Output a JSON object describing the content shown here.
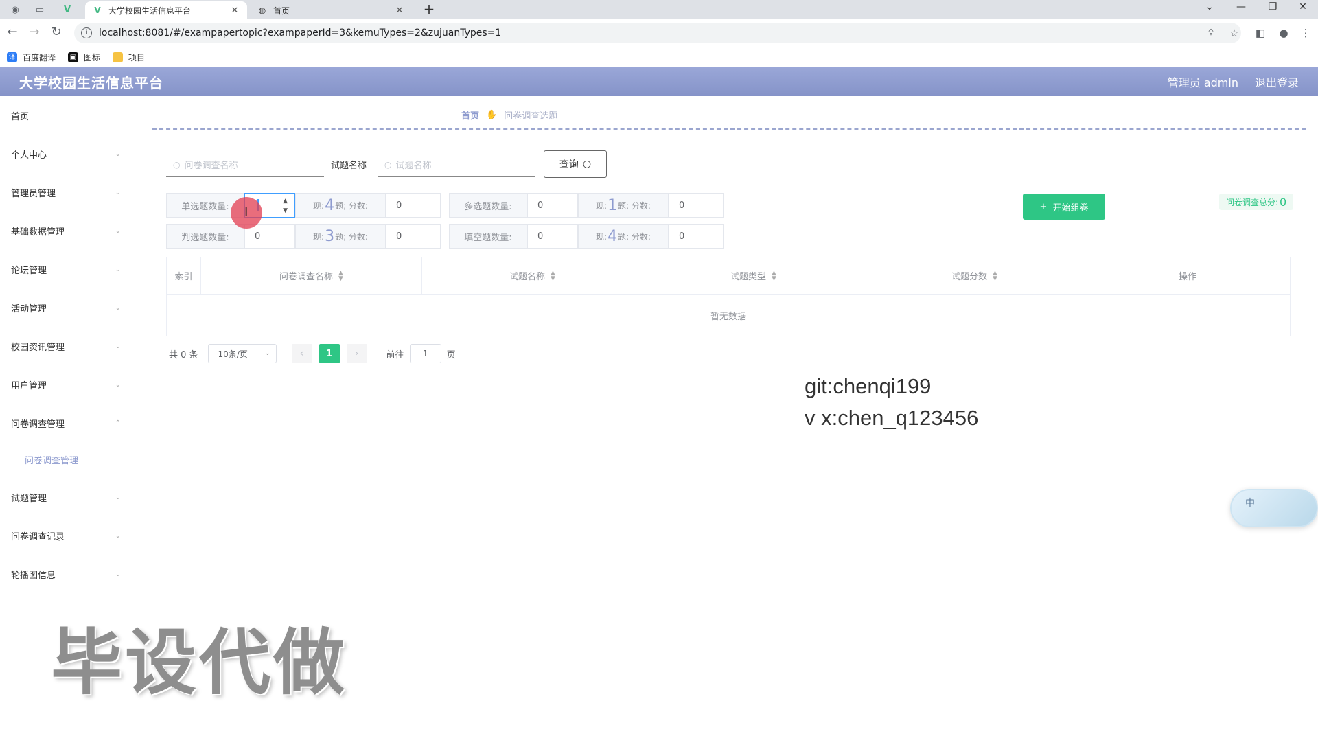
{
  "browser": {
    "tabs": [
      {
        "title": "大学校园生活信息平台",
        "icon": "vue-logo-icon",
        "active": true
      },
      {
        "title": "首页",
        "icon": "globe-icon",
        "active": false
      }
    ],
    "url": "localhost:8081/#/exampapertopic?exampaperId=3&kemuTypes=2&zujuanTypes=1",
    "bookmarks": [
      "百度翻译",
      "图标",
      "项目"
    ],
    "window_controls": [
      "⌄",
      "—",
      "❐",
      "✕"
    ]
  },
  "app": {
    "title": "大学校园生活信息平台",
    "user_label": "管理员 admin",
    "logout": "退出登录"
  },
  "sidebar": {
    "items": [
      {
        "label": "首页",
        "has_children": false
      },
      {
        "label": "个人中心",
        "has_children": true
      },
      {
        "label": "管理员管理",
        "has_children": true
      },
      {
        "label": "基础数据管理",
        "has_children": true
      },
      {
        "label": "论坛管理",
        "has_children": true
      },
      {
        "label": "活动管理",
        "has_children": true
      },
      {
        "label": "校园资讯管理",
        "has_children": true
      },
      {
        "label": "用户管理",
        "has_children": true
      },
      {
        "label": "问卷调查管理",
        "has_children": true,
        "expanded": true
      },
      {
        "label": "试题管理",
        "has_children": true
      },
      {
        "label": "问卷调查记录",
        "has_children": true
      },
      {
        "label": "轮播图信息",
        "has_children": true
      }
    ],
    "sub_item": "问卷调查管理"
  },
  "breadcrumb": {
    "home": "首页",
    "current": "问卷调查选题"
  },
  "search": {
    "paper_placeholder": "问卷调查名称",
    "question_label": "试题名称",
    "question_placeholder": "试题名称",
    "query_button": "查询"
  },
  "config": {
    "single": {
      "label": "单选题数量:",
      "value": "1",
      "have": "4",
      "score": "0"
    },
    "multi": {
      "label": "多选题数量:",
      "value": "0",
      "have": "1",
      "score": "0"
    },
    "judge": {
      "label": "判选题数量:",
      "value": "0",
      "have": "3",
      "score": "0"
    },
    "fill": {
      "label": "填空题数量:",
      "value": "0",
      "have": "4",
      "score": "0"
    },
    "have_prefix": "现:",
    "have_suffix": "题;  分数:"
  },
  "start_button": "开始组卷",
  "total": {
    "label": "问卷调查总分:",
    "value": "0"
  },
  "table": {
    "columns": [
      "索引",
      "问卷调查名称",
      "试题名称",
      "试题类型",
      "试题分数",
      "操作"
    ],
    "empty_text": "暂无数据"
  },
  "pagination": {
    "total_text": "共 0 条",
    "page_size": "10条/页",
    "current_page": "1",
    "goto_label": "前往",
    "goto_value": "1",
    "page_suffix": "页"
  },
  "overlay": {
    "git": "git:chenqi199",
    "wx": "v x:chen_q123456",
    "bishe": "毕设代做",
    "widget_char": "中"
  }
}
